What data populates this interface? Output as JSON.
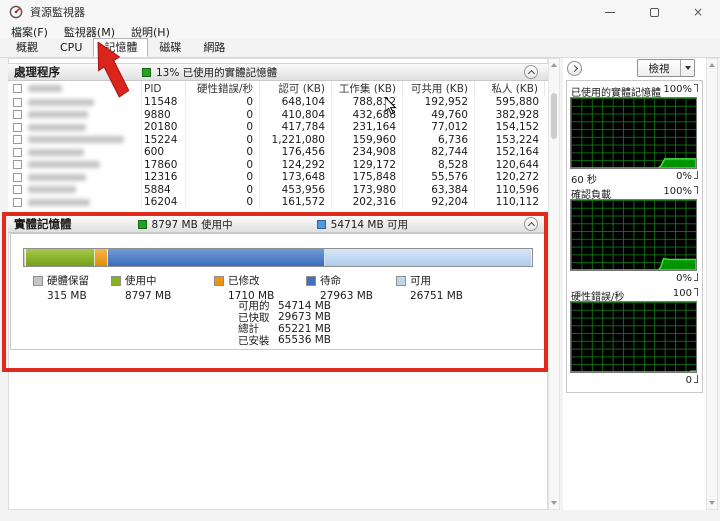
{
  "window": {
    "title": "資源監視器"
  },
  "menu": {
    "items": [
      "檔案(F)",
      "監視器(M)",
      "說明(H)"
    ]
  },
  "tabs": [
    {
      "label": "概觀",
      "active": false
    },
    {
      "label": "CPU",
      "active": false
    },
    {
      "label": "記憶體",
      "active": true
    },
    {
      "label": "磁碟",
      "active": false
    },
    {
      "label": "網路",
      "active": false
    }
  ],
  "process_section": {
    "title": "處理程序",
    "status": "13% 已使用的實體記憶體",
    "columns": [
      "PID",
      "硬性錯誤/秒",
      "認可 (KB)",
      "工作集 (KB)",
      "可共用 (KB)",
      "私人 (KB)"
    ],
    "rows": [
      {
        "pid": "11548",
        "hard_faults": "0",
        "commit": "648,104",
        "working_set": "788,832",
        "shareable": "192,952",
        "private": "595,880",
        "name_w": 66
      },
      {
        "pid": "9880",
        "hard_faults": "0",
        "commit": "410,804",
        "working_set": "432,688",
        "shareable": "49,760",
        "private": "382,928",
        "name_w": 60
      },
      {
        "pid": "20180",
        "hard_faults": "0",
        "commit": "417,784",
        "working_set": "231,164",
        "shareable": "77,012",
        "private": "154,152",
        "name_w": 58
      },
      {
        "pid": "15224",
        "hard_faults": "0",
        "commit": "1,221,080",
        "working_set": "159,960",
        "shareable": "6,736",
        "private": "153,224",
        "name_w": 96
      },
      {
        "pid": "600",
        "hard_faults": "0",
        "commit": "176,456",
        "working_set": "234,908",
        "shareable": "82,744",
        "private": "152,164",
        "name_w": 56
      },
      {
        "pid": "17860",
        "hard_faults": "0",
        "commit": "124,292",
        "working_set": "129,172",
        "shareable": "8,528",
        "private": "120,644",
        "name_w": 72
      },
      {
        "pid": "12316",
        "hard_faults": "0",
        "commit": "173,648",
        "working_set": "175,848",
        "shareable": "55,576",
        "private": "120,272",
        "name_w": 58
      },
      {
        "pid": "5884",
        "hard_faults": "0",
        "commit": "453,956",
        "working_set": "173,980",
        "shareable": "63,384",
        "private": "110,596",
        "name_w": 48
      },
      {
        "pid": "16204",
        "hard_faults": "0",
        "commit": "161,572",
        "working_set": "202,316",
        "shareable": "92,204",
        "private": "110,112",
        "name_w": 62
      }
    ]
  },
  "memory_section": {
    "title": "實體記憶體",
    "status_used": "8797 MB 使用中",
    "status_available": "54714 MB 可用",
    "total_mb": 65536,
    "bar_segments": [
      {
        "label": "硬體保留",
        "mb": 315,
        "color": "#c3c3c3",
        "color_top": "#dedede"
      },
      {
        "label": "使用中",
        "mb": 8797,
        "color": "#74a017",
        "color_top": "#a3c94a"
      },
      {
        "label": "已修改",
        "mb": 1710,
        "color": "#e08a07",
        "color_top": "#f6b64f"
      },
      {
        "label": "待命",
        "mb": 27963,
        "color": "#3a6cbd",
        "color_top": "#6f9bd8"
      },
      {
        "label": "可用",
        "mb": 26751,
        "color": "#afccea",
        "color_top": "#d6e7f8"
      }
    ],
    "legend": [
      {
        "label": "硬體保留",
        "value": "315 MB",
        "color": "#c6c6c6"
      },
      {
        "label": "使用中",
        "value": "8797 MB",
        "color": "#86b021"
      },
      {
        "label": "已修改",
        "value": "1710 MB",
        "color": "#eb9612"
      },
      {
        "label": "待命",
        "value": "27963 MB",
        "color": "#3e72c1"
      },
      {
        "label": "可用",
        "value": "26751 MB",
        "color": "#bdd7f0"
      }
    ],
    "stats": [
      {
        "label": "可用的",
        "value": "54714 MB"
      },
      {
        "label": "已快取",
        "value": "29673 MB"
      },
      {
        "label": "總計",
        "value": "65221 MB"
      },
      {
        "label": "已安裝",
        "value": "65536 MB"
      }
    ]
  },
  "sidebar": {
    "view_label": "檢視",
    "charts": [
      {
        "title": "已使用的實體記憶體",
        "scale_max": "100%",
        "scale_min": "0%",
        "x_label": "60 秒",
        "history": [
          [
            0,
            0
          ],
          [
            70,
            0
          ],
          [
            72,
            3
          ],
          [
            75,
            13
          ],
          [
            100,
            13
          ]
        ]
      },
      {
        "title": "確認負載",
        "scale_max": "100%",
        "scale_min": "0%",
        "x_label": "",
        "history": [
          [
            0,
            0
          ],
          [
            70,
            0
          ],
          [
            72,
            5
          ],
          [
            74,
            16
          ],
          [
            79,
            15
          ],
          [
            100,
            15
          ]
        ]
      },
      {
        "title": "硬性錯誤/秒",
        "scale_max": "100",
        "scale_min": "0",
        "x_label": "",
        "history": [
          [
            0,
            0
          ],
          [
            95,
            0
          ],
          [
            96,
            1
          ],
          [
            100,
            1
          ]
        ]
      }
    ],
    "chart_colors": {
      "bg": "#000000",
      "grid": "#0c6e0c",
      "area_fill": "#00a300",
      "area_stroke": "#3ce43c"
    }
  },
  "colors": {
    "used_green": "#23a223",
    "available_blue": "#4f9ae4",
    "annotation_red": "#e02a1c"
  }
}
